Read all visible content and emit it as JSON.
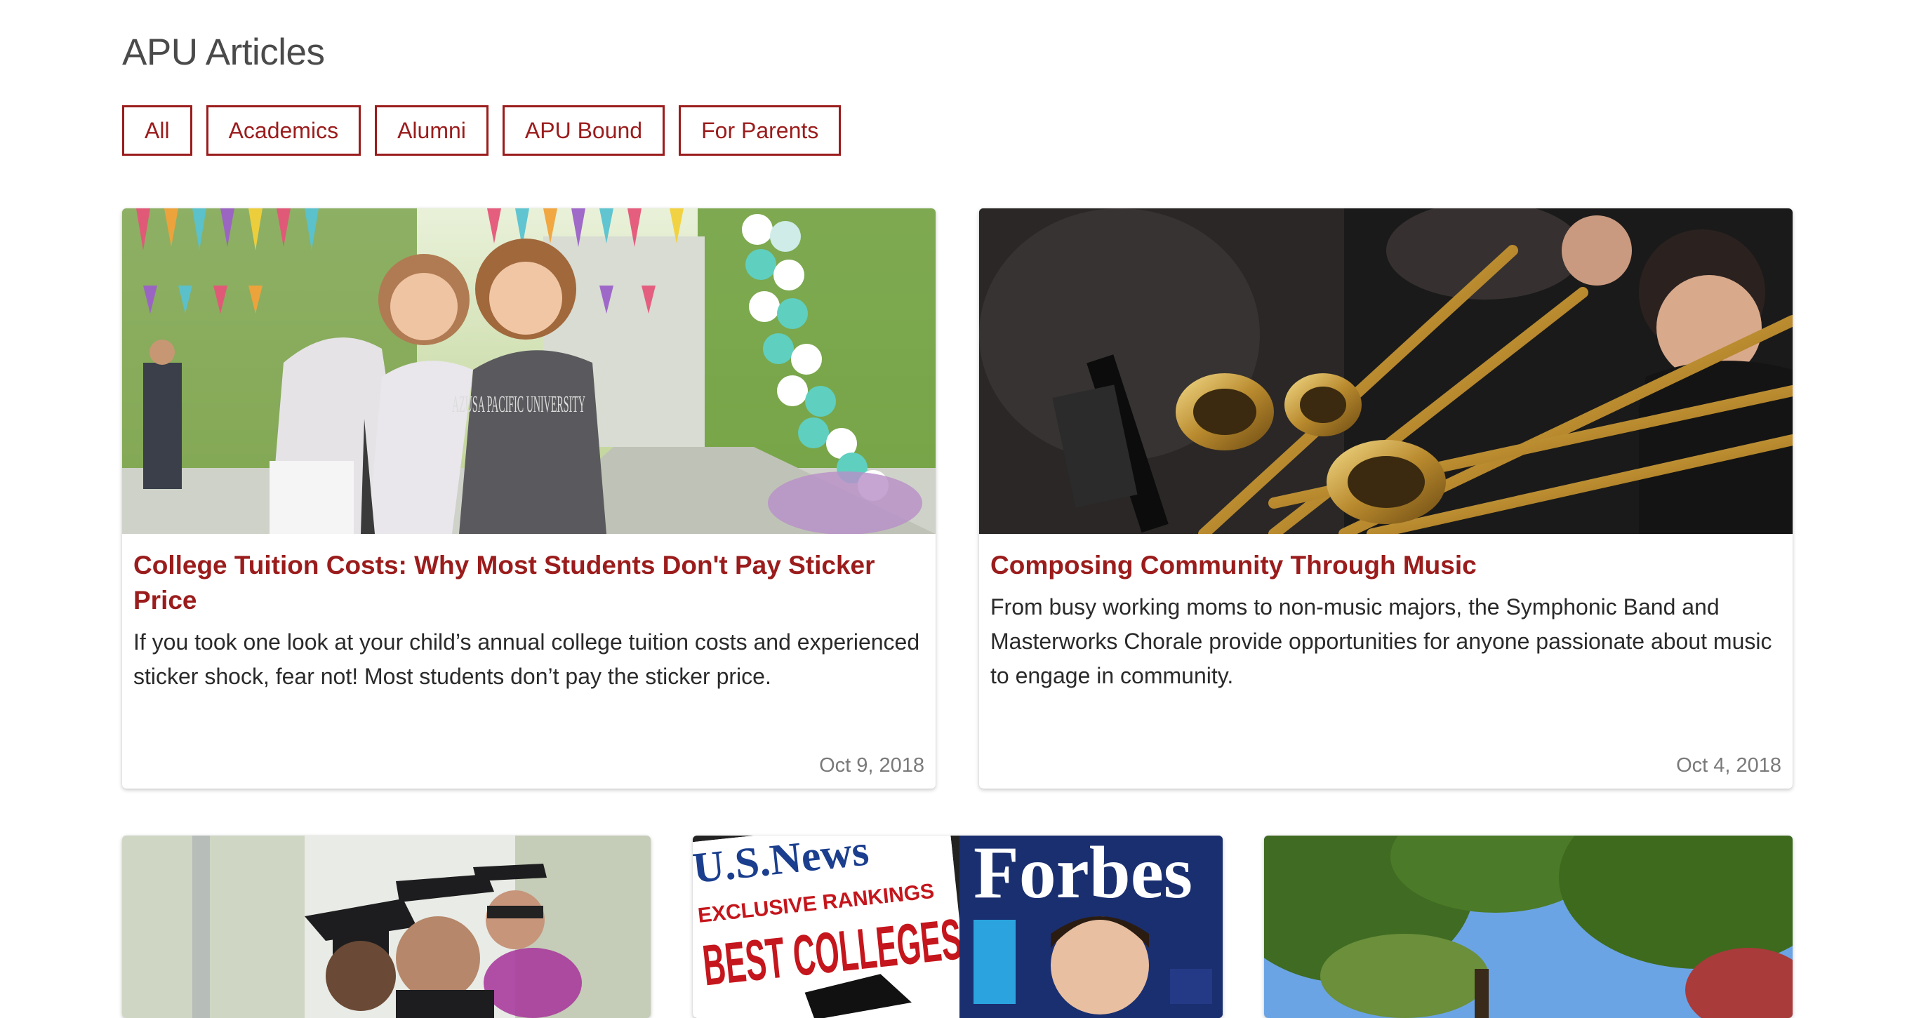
{
  "page": {
    "title": "APU Articles"
  },
  "filters": [
    "All",
    "Academics",
    "Alumni",
    "APU Bound",
    "For Parents"
  ],
  "articles": [
    {
      "title": "College Tuition Costs: Why Most Students Don't Pay Sticker Price",
      "excerpt": "If you took one look at your child’s annual college tuition costs and experienced sticker shock, fear not! Most students don’t pay the sticker price.",
      "date": "Oct 9, 2018",
      "image": "photo-mother-daughter-campus",
      "shirt_text": "AZUSA PACIFIC UNIVERSITY"
    },
    {
      "title": "Composing Community Through Music",
      "excerpt": "From busy working moms to non-music majors, the Symphonic Band and Masterworks Chorale provide opportunities for anyone passionate about music to engage in community.",
      "date": "Oct 4, 2018",
      "image": "photo-trombone-band"
    }
  ],
  "preview_cards": [
    {
      "image": "photo-graduates"
    },
    {
      "image": "photo-magazines",
      "mag1_title": "U.S.News",
      "mag1_sub": "EXCLUSIVE RANKINGS",
      "mag1_head": "BEST COLLEGES",
      "mag2_title": "Forbes"
    },
    {
      "image": "photo-trees-sky"
    }
  ],
  "colors": {
    "accent": "#9b1c1c",
    "title": "#4a4a4a",
    "date": "#7a7a7a"
  }
}
